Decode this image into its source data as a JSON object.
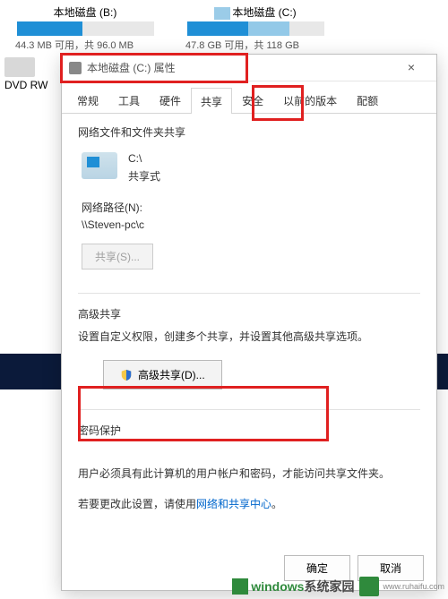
{
  "background": {
    "drive_b": {
      "title": "本地磁盘 (B:)",
      "info": "44.3 MB 可用，共 96.0 MB"
    },
    "drive_c": {
      "title": "本地磁盘 (C:)",
      "info": "47.8 GB 可用，共 118 GB"
    },
    "dvd": "DVD RW"
  },
  "dialog": {
    "title": "本地磁盘 (C:) 属性",
    "tabs": {
      "general": "常规",
      "tools": "工具",
      "hardware": "硬件",
      "sharing": "共享",
      "security": "安全",
      "previous": "以前的版本",
      "quota": "配额"
    },
    "share_section": {
      "heading": "网络文件和文件夹共享",
      "path_name": "C:\\",
      "share_mode": "共享式",
      "netpath_label": "网络路径(N):",
      "netpath_value": "\\\\Steven-pc\\c",
      "share_btn": "共享(S)..."
    },
    "advanced_section": {
      "heading": "高级共享",
      "desc": "设置自定义权限，创建多个共享，并设置其他高级共享选项。",
      "btn": "高级共享(D)..."
    },
    "password_section": {
      "heading": "密码保护",
      "desc1": "用户必须具有此计算机的用户帐户和密码，才能访问共享文件夹。",
      "desc2_pre": "若要更改此设置，请使用",
      "desc2_link": "网络和共享中心",
      "desc2_post": "。"
    },
    "buttons": {
      "ok": "确定",
      "cancel": "取消"
    }
  },
  "watermark": {
    "text1": "windows",
    "text2": "系统家园",
    "sub": "www.ruhaifu.com"
  }
}
